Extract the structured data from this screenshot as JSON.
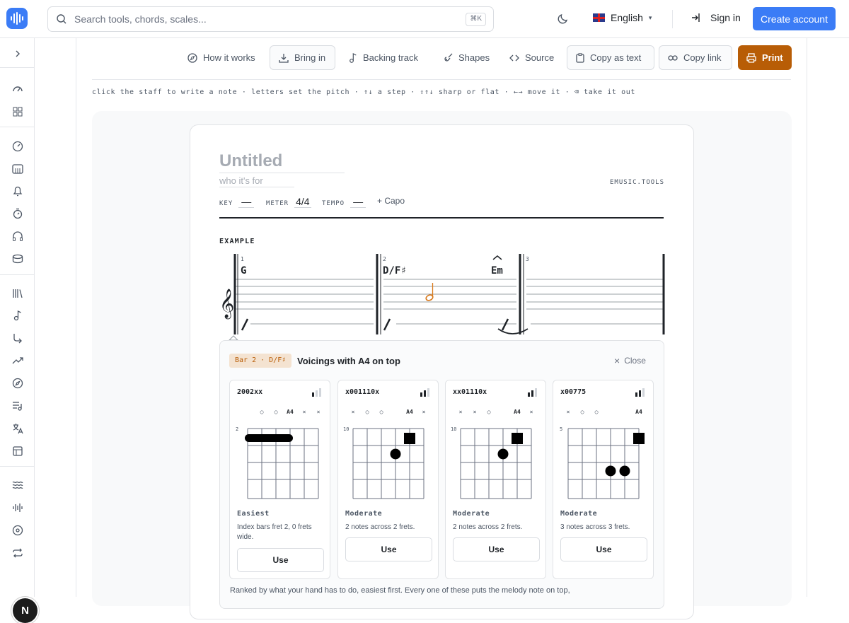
{
  "search": {
    "placeholder": "Search tools, chords, scales...",
    "shortcut": "⌘K"
  },
  "header": {
    "language": "English",
    "signin": "Sign in",
    "create_account": "Create account"
  },
  "toolbar": {
    "how_it_works": "How it works",
    "bring_in": "Bring in",
    "backing_track": "Backing track",
    "shapes": "Shapes",
    "source": "Source",
    "copy_as_text": "Copy as text",
    "copy_link": "Copy link",
    "print": "Print"
  },
  "hint": "click the staff to write a note · letters set the pitch · ↑↓ a step · ⇧↑↓ sharp or flat · ←→ move it · ⌫ take it out",
  "sheet": {
    "title_placeholder": "Untitled",
    "subtitle_placeholder": "who it's for",
    "brand": "EMUSIC.TOOLS",
    "key_label": "KEY",
    "key_value": "—",
    "meter_label": "METER",
    "meter_value": "4/4",
    "tempo_label": "TEMPO",
    "tempo_value": "—",
    "capo_label": "+ Capo",
    "example_label": "EXAMPLE",
    "bars": [
      {
        "number": "1",
        "chord": "G"
      },
      {
        "number": "2",
        "chord": "D/F♯"
      },
      {
        "number": "3",
        "chord": ""
      }
    ],
    "extra_chord": "Em"
  },
  "voicings": {
    "bar_tag": "Bar 2 · D/F♯",
    "title": "Voicings with A4 on top",
    "close": "Close",
    "cards": [
      {
        "code": "2002xx",
        "marks": [
          "",
          "○",
          "○",
          "A4",
          "×",
          "×"
        ],
        "fret": "2",
        "level": "Easiest",
        "desc": "Index bars fret 2, 0 frets wide.",
        "use": "Use"
      },
      {
        "code": "x001110x",
        "marks": [
          "×",
          "○",
          "○",
          "",
          "A4",
          "×"
        ],
        "fret": "10",
        "level": "Moderate",
        "desc": "2 notes across 2 frets.",
        "use": "Use"
      },
      {
        "code": "xx01110x",
        "marks": [
          "×",
          "×",
          "○",
          "",
          "A4",
          "×"
        ],
        "fret": "10",
        "level": "Moderate",
        "desc": "2 notes across 2 frets.",
        "use": "Use"
      },
      {
        "code": "x00775",
        "marks": [
          "×",
          "○",
          "○",
          "",
          "",
          "A4"
        ],
        "fret": "5",
        "level": "Moderate",
        "desc": "3 notes across 3 frets.",
        "use": "Use"
      }
    ],
    "footnote": "Ranked by what your hand has to do, easiest first. Every one of these puts the melody note on top,"
  },
  "avatar_letter": "N",
  "colors": {
    "accent": "#3b7cf6",
    "print": "#b85d06",
    "note": "#d97a1c"
  }
}
